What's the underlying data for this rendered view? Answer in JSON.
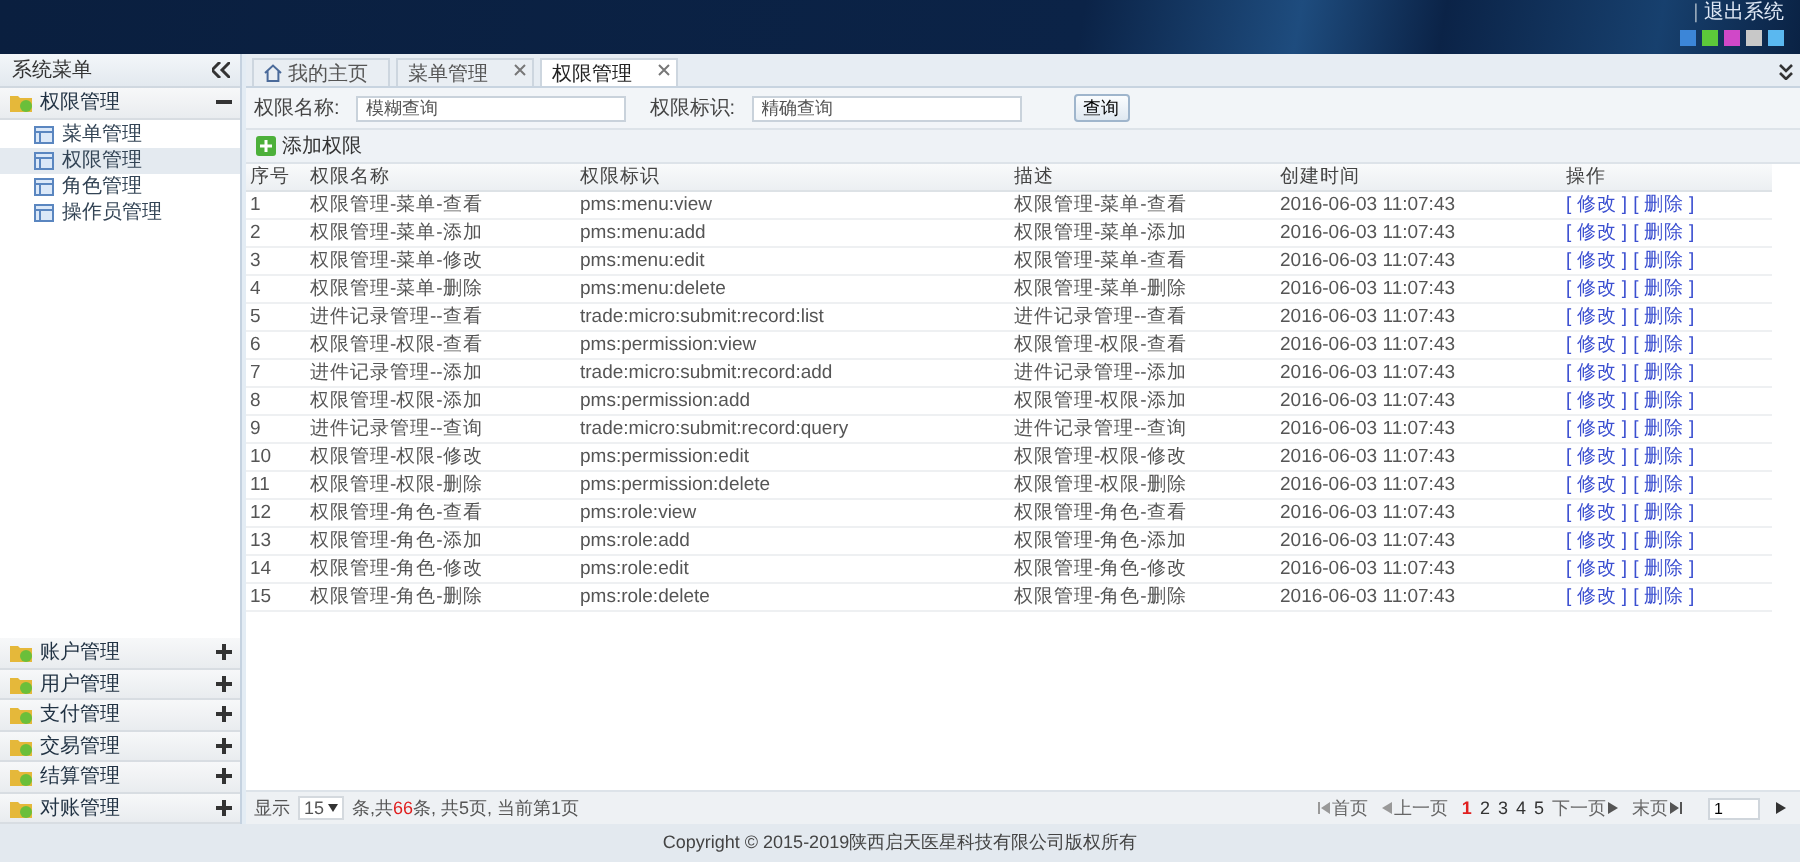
{
  "header": {
    "separator": "|",
    "logout": "退出系统",
    "themes": [
      {
        "color": "#3c86d8"
      },
      {
        "color": "#5cc83a"
      },
      {
        "color": "#d048c8"
      },
      {
        "color": "#c8c8c8"
      },
      {
        "color": "#5ab8f0"
      }
    ]
  },
  "sidebar": {
    "title": "系统菜单",
    "sections": [
      {
        "label": "权限管理",
        "expanded": true,
        "children": [
          {
            "label": "菜单管理",
            "selected": false
          },
          {
            "label": "权限管理",
            "selected": true
          },
          {
            "label": "角色管理",
            "selected": false
          },
          {
            "label": "操作员管理",
            "selected": false
          }
        ]
      },
      {
        "label": "账户管理",
        "expanded": false
      },
      {
        "label": "用户管理",
        "expanded": false
      },
      {
        "label": "支付管理",
        "expanded": false
      },
      {
        "label": "交易管理",
        "expanded": false
      },
      {
        "label": "结算管理",
        "expanded": false
      },
      {
        "label": "对账管理",
        "expanded": false
      }
    ]
  },
  "tabs": [
    {
      "label": "我的主页",
      "kind": "home",
      "closable": false,
      "selected": false
    },
    {
      "label": "菜单管理",
      "kind": "page",
      "closable": true,
      "selected": false
    },
    {
      "label": "权限管理",
      "kind": "page",
      "closable": true,
      "selected": true
    }
  ],
  "search": {
    "fields": [
      {
        "label": "权限名称:",
        "placeholder": "模糊查询"
      },
      {
        "label": "权限标识:",
        "placeholder": "精确查询"
      }
    ],
    "button": "查询"
  },
  "toolbar": {
    "add": "添加权限"
  },
  "table": {
    "columns": [
      "序号",
      "权限名称",
      "权限标识",
      "描述",
      "创建时间",
      "操作"
    ],
    "rows": [
      {
        "cells": [
          "1",
          "权限管理-菜单-查看",
          "pms:menu:view",
          "权限管理-菜单-查看",
          "2016-06-03 11:07:43"
        ],
        "actions": [
          "[ 修改 ]",
          "[ 删除 ]"
        ]
      },
      {
        "cells": [
          "2",
          "权限管理-菜单-添加",
          "pms:menu:add",
          "权限管理-菜单-添加",
          "2016-06-03 11:07:43"
        ],
        "actions": [
          "[ 修改 ]",
          "[ 删除 ]"
        ]
      },
      {
        "cells": [
          "3",
          "权限管理-菜单-修改",
          "pms:menu:edit",
          "权限管理-菜单-查看",
          "2016-06-03 11:07:43"
        ],
        "actions": [
          "[ 修改 ]",
          "[ 删除 ]"
        ]
      },
      {
        "cells": [
          "4",
          "权限管理-菜单-删除",
          "pms:menu:delete",
          "权限管理-菜单-删除",
          "2016-06-03 11:07:43"
        ],
        "actions": [
          "[ 修改 ]",
          "[ 删除 ]"
        ]
      },
      {
        "cells": [
          "5",
          "进件记录管理--查看",
          "trade:micro:submit:record:list",
          "进件记录管理--查看",
          "2016-06-03 11:07:43"
        ],
        "actions": [
          "[ 修改 ]",
          "[ 删除 ]"
        ]
      },
      {
        "cells": [
          "6",
          "权限管理-权限-查看",
          "pms:permission:view",
          "权限管理-权限-查看",
          "2016-06-03 11:07:43"
        ],
        "actions": [
          "[ 修改 ]",
          "[ 删除 ]"
        ]
      },
      {
        "cells": [
          "7",
          "进件记录管理--添加",
          "trade:micro:submit:record:add",
          "进件记录管理--添加",
          "2016-06-03 11:07:43"
        ],
        "actions": [
          "[ 修改 ]",
          "[ 删除 ]"
        ]
      },
      {
        "cells": [
          "8",
          "权限管理-权限-添加",
          "pms:permission:add",
          "权限管理-权限-添加",
          "2016-06-03 11:07:43"
        ],
        "actions": [
          "[ 修改 ]",
          "[ 删除 ]"
        ]
      },
      {
        "cells": [
          "9",
          "进件记录管理--查询",
          "trade:micro:submit:record:query",
          "进件记录管理--查询",
          "2016-06-03 11:07:43"
        ],
        "actions": [
          "[ 修改 ]",
          "[ 删除 ]"
        ]
      },
      {
        "cells": [
          "10",
          "权限管理-权限-修改",
          "pms:permission:edit",
          "权限管理-权限-修改",
          "2016-06-03 11:07:43"
        ],
        "actions": [
          "[ 修改 ]",
          "[ 删除 ]"
        ]
      },
      {
        "cells": [
          "11",
          "权限管理-权限-删除",
          "pms:permission:delete",
          "权限管理-权限-删除",
          "2016-06-03 11:07:43"
        ],
        "actions": [
          "[ 修改 ]",
          "[ 删除 ]"
        ]
      },
      {
        "cells": [
          "12",
          "权限管理-角色-查看",
          "pms:role:view",
          "权限管理-角色-查看",
          "2016-06-03 11:07:43"
        ],
        "actions": [
          "[ 修改 ]",
          "[ 删除 ]"
        ]
      },
      {
        "cells": [
          "13",
          "权限管理-角色-添加",
          "pms:role:add",
          "权限管理-角色-添加",
          "2016-06-03 11:07:43"
        ],
        "actions": [
          "[ 修改 ]",
          "[ 删除 ]"
        ]
      },
      {
        "cells": [
          "14",
          "权限管理-角色-修改",
          "pms:role:edit",
          "权限管理-角色-修改",
          "2016-06-03 11:07:43"
        ],
        "actions": [
          "[ 修改 ]",
          "[ 删除 ]"
        ]
      },
      {
        "cells": [
          "15",
          "权限管理-角色-删除",
          "pms:role:delete",
          "权限管理-角色-删除",
          "2016-06-03 11:07:43"
        ],
        "actions": [
          "[ 修改 ]",
          "[ 删除 ]"
        ]
      }
    ]
  },
  "pager": {
    "show": "显示",
    "page_size": "15",
    "summary": {
      "before": "条,共",
      "count": "66",
      "after": "条, 共5页, 当前第1页"
    },
    "first": "首页",
    "prev": "上一页",
    "pages": [
      {
        "label": "1",
        "selected": true
      },
      {
        "label": "2",
        "selected": false
      },
      {
        "label": "3",
        "selected": false
      },
      {
        "label": "4",
        "selected": false
      },
      {
        "label": "5",
        "selected": false
      }
    ],
    "next": "下一页",
    "last": "末页",
    "page_input": "1"
  },
  "footer": "Copyright © 2015-2019陕西启天医星科技有限公司版权所有"
}
